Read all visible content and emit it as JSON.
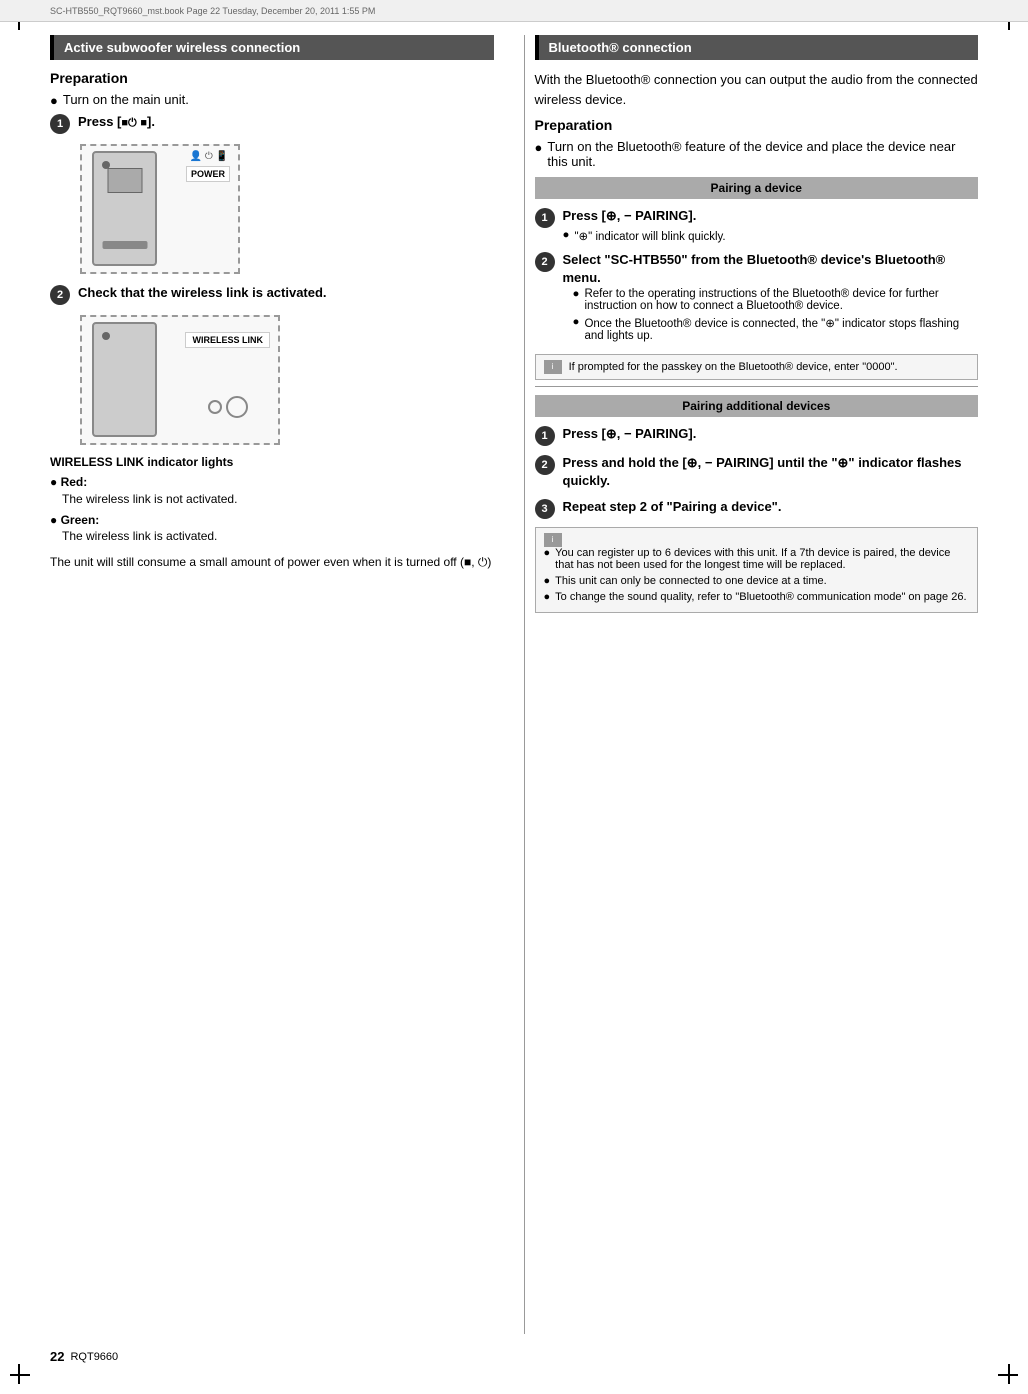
{
  "page": {
    "header_text": "SC-HTB550_RQT9660_mst.book  Page 22  Tuesday, December 20, 2011  1:55 PM",
    "page_number": "22",
    "page_code": "RQT9660"
  },
  "left_column": {
    "section_title": "Active subwoofer wireless connection",
    "prep_heading": "Preparation",
    "prep_bullet": "Turn on the main unit.",
    "step1": {
      "num": "1",
      "title": "Press [■⏻ ■]."
    },
    "step2": {
      "num": "2",
      "title": "Check that the wireless link is activated."
    },
    "indicator_heading": "WIRELESS LINK indicator lights",
    "red_label": "Red:",
    "red_text": "The wireless link is not activated.",
    "green_label": "Green:",
    "green_text": "The wireless link is activated.",
    "footer_text": "The unit will still consume a small amount of power even when it is turned off (■, ⏻)"
  },
  "right_column": {
    "section_title": "Bluetooth® connection",
    "intro": "With the Bluetooth® connection you can output the audio from the connected wireless device.",
    "prep_heading": "Preparation",
    "prep_bullet": "Turn on the Bluetooth® feature of the device and place the device near this unit.",
    "pairing_device_title": "Pairing a device",
    "pairing_step1": {
      "num": "1",
      "title": "Press [⊕, − PAIRING].",
      "sub": "\"⊕\" indicator will blink quickly."
    },
    "pairing_step2": {
      "num": "2",
      "title": "Select \"SC-HTB550\" from the Bluetooth® device's Bluetooth® menu.",
      "sub1": "Refer to the operating instructions of the Bluetooth® device for further instruction on how to connect a Bluetooth® device.",
      "sub2": "Once the Bluetooth® device is connected, the \"⊕\" indicator stops flashing and lights up."
    },
    "note1": "If prompted for the passkey on the Bluetooth® device, enter \"0000\".",
    "pairing_additional_title": "Pairing additional devices",
    "add_step1": {
      "num": "1",
      "title": "Press [⊕, − PAIRING]."
    },
    "add_step2": {
      "num": "2",
      "title": "Press and hold the [⊕, − PAIRING] until the \"⊕\" indicator flashes quickly."
    },
    "add_step3": {
      "num": "3",
      "title": "Repeat step 2 of \"Pairing a device\"."
    },
    "note2_bullets": [
      "You can register up to 6 devices with this unit. If a 7th device is paired, the device that has not been used for the longest time will be replaced.",
      "This unit can only be connected to one device at a time.",
      "To change the sound quality, refer to \"Bluetooth® communication mode\" on page 26."
    ]
  }
}
